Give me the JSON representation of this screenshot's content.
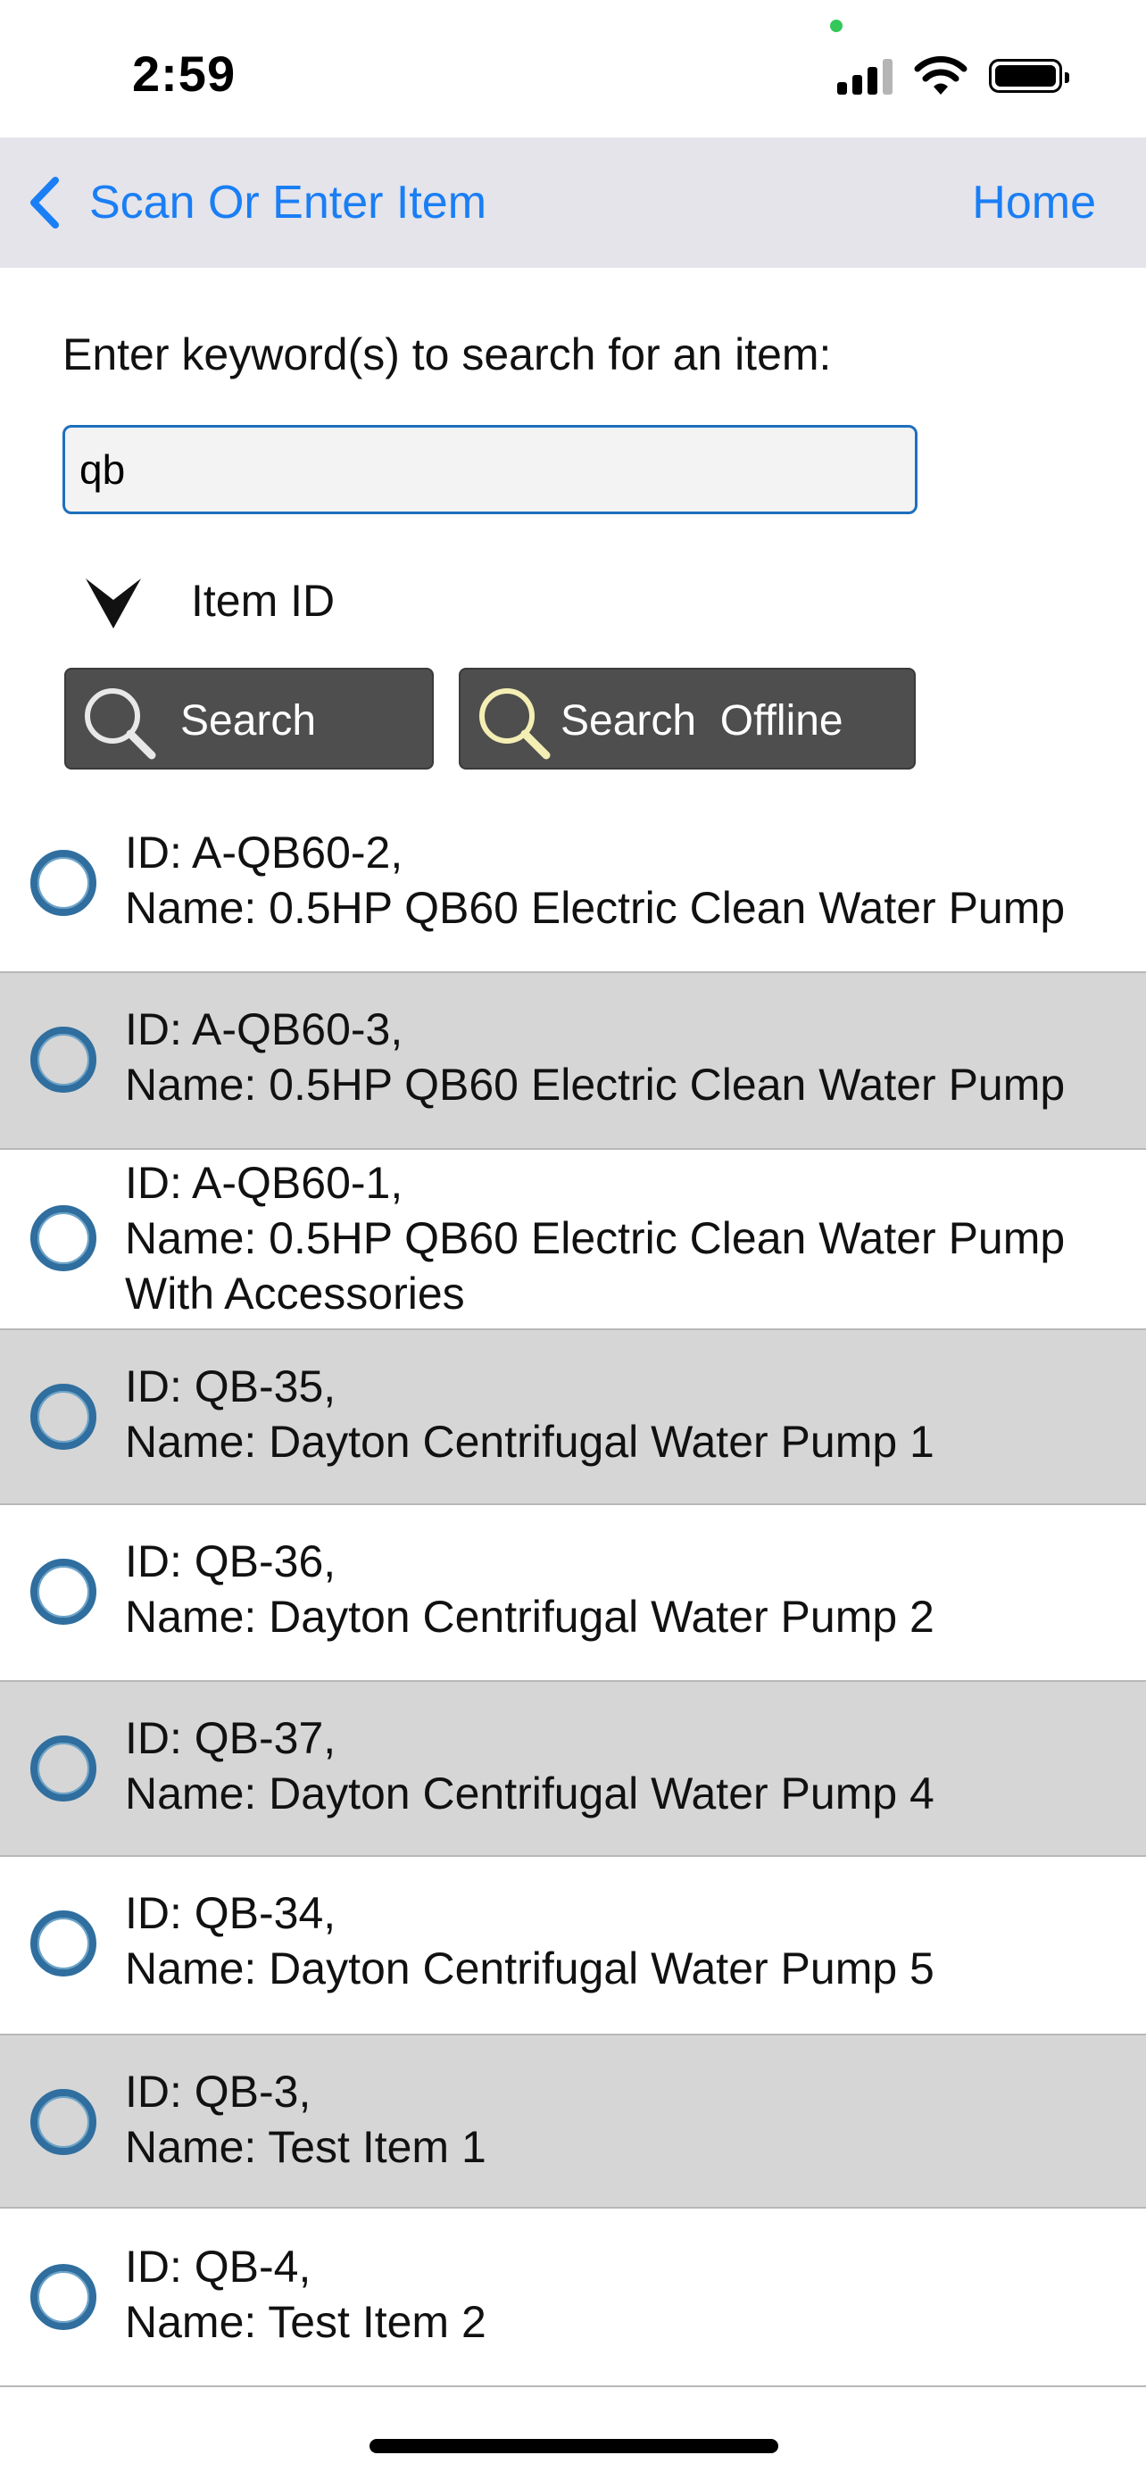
{
  "status_bar": {
    "time": "2:59",
    "privacy_dot_color": "#34c759"
  },
  "nav": {
    "back_label": "Scan Or Enter Item",
    "home_label": "Home",
    "accent_color": "#1a7ef5"
  },
  "search": {
    "prompt": "Enter keyword(s) to search for an item:",
    "value": "qb",
    "field_label": "Item ID",
    "search_button": "Search",
    "offline_button": "Search  Offline"
  },
  "results": [
    {
      "id_line": "ID: A-QB60-2,",
      "name_line": "Name: 0.5HP QB60 Electric Clean Water Pump",
      "extra_line": ""
    },
    {
      "id_line": "ID: A-QB60-3,",
      "name_line": "Name: 0.5HP QB60 Electric Clean Water Pump",
      "extra_line": ""
    },
    {
      "id_line": "ID: A-QB60-1,",
      "name_line": "Name: 0.5HP QB60 Electric Clean Water Pump",
      "extra_line": "With Accessories"
    },
    {
      "id_line": "ID: QB-35,",
      "name_line": "Name: Dayton Centrifugal Water Pump 1",
      "extra_line": ""
    },
    {
      "id_line": "ID: QB-36,",
      "name_line": "Name: Dayton Centrifugal Water Pump 2",
      "extra_line": ""
    },
    {
      "id_line": "ID: QB-37,",
      "name_line": "Name: Dayton Centrifugal Water Pump 4",
      "extra_line": ""
    },
    {
      "id_line": "ID: QB-34,",
      "name_line": "Name: Dayton Centrifugal Water Pump 5",
      "extra_line": ""
    },
    {
      "id_line": "ID: QB-3,",
      "name_line": "Name: Test Item 1",
      "extra_line": ""
    },
    {
      "id_line": "ID: QB-4,",
      "name_line": "Name: Test Item 2",
      "extra_line": ""
    }
  ]
}
